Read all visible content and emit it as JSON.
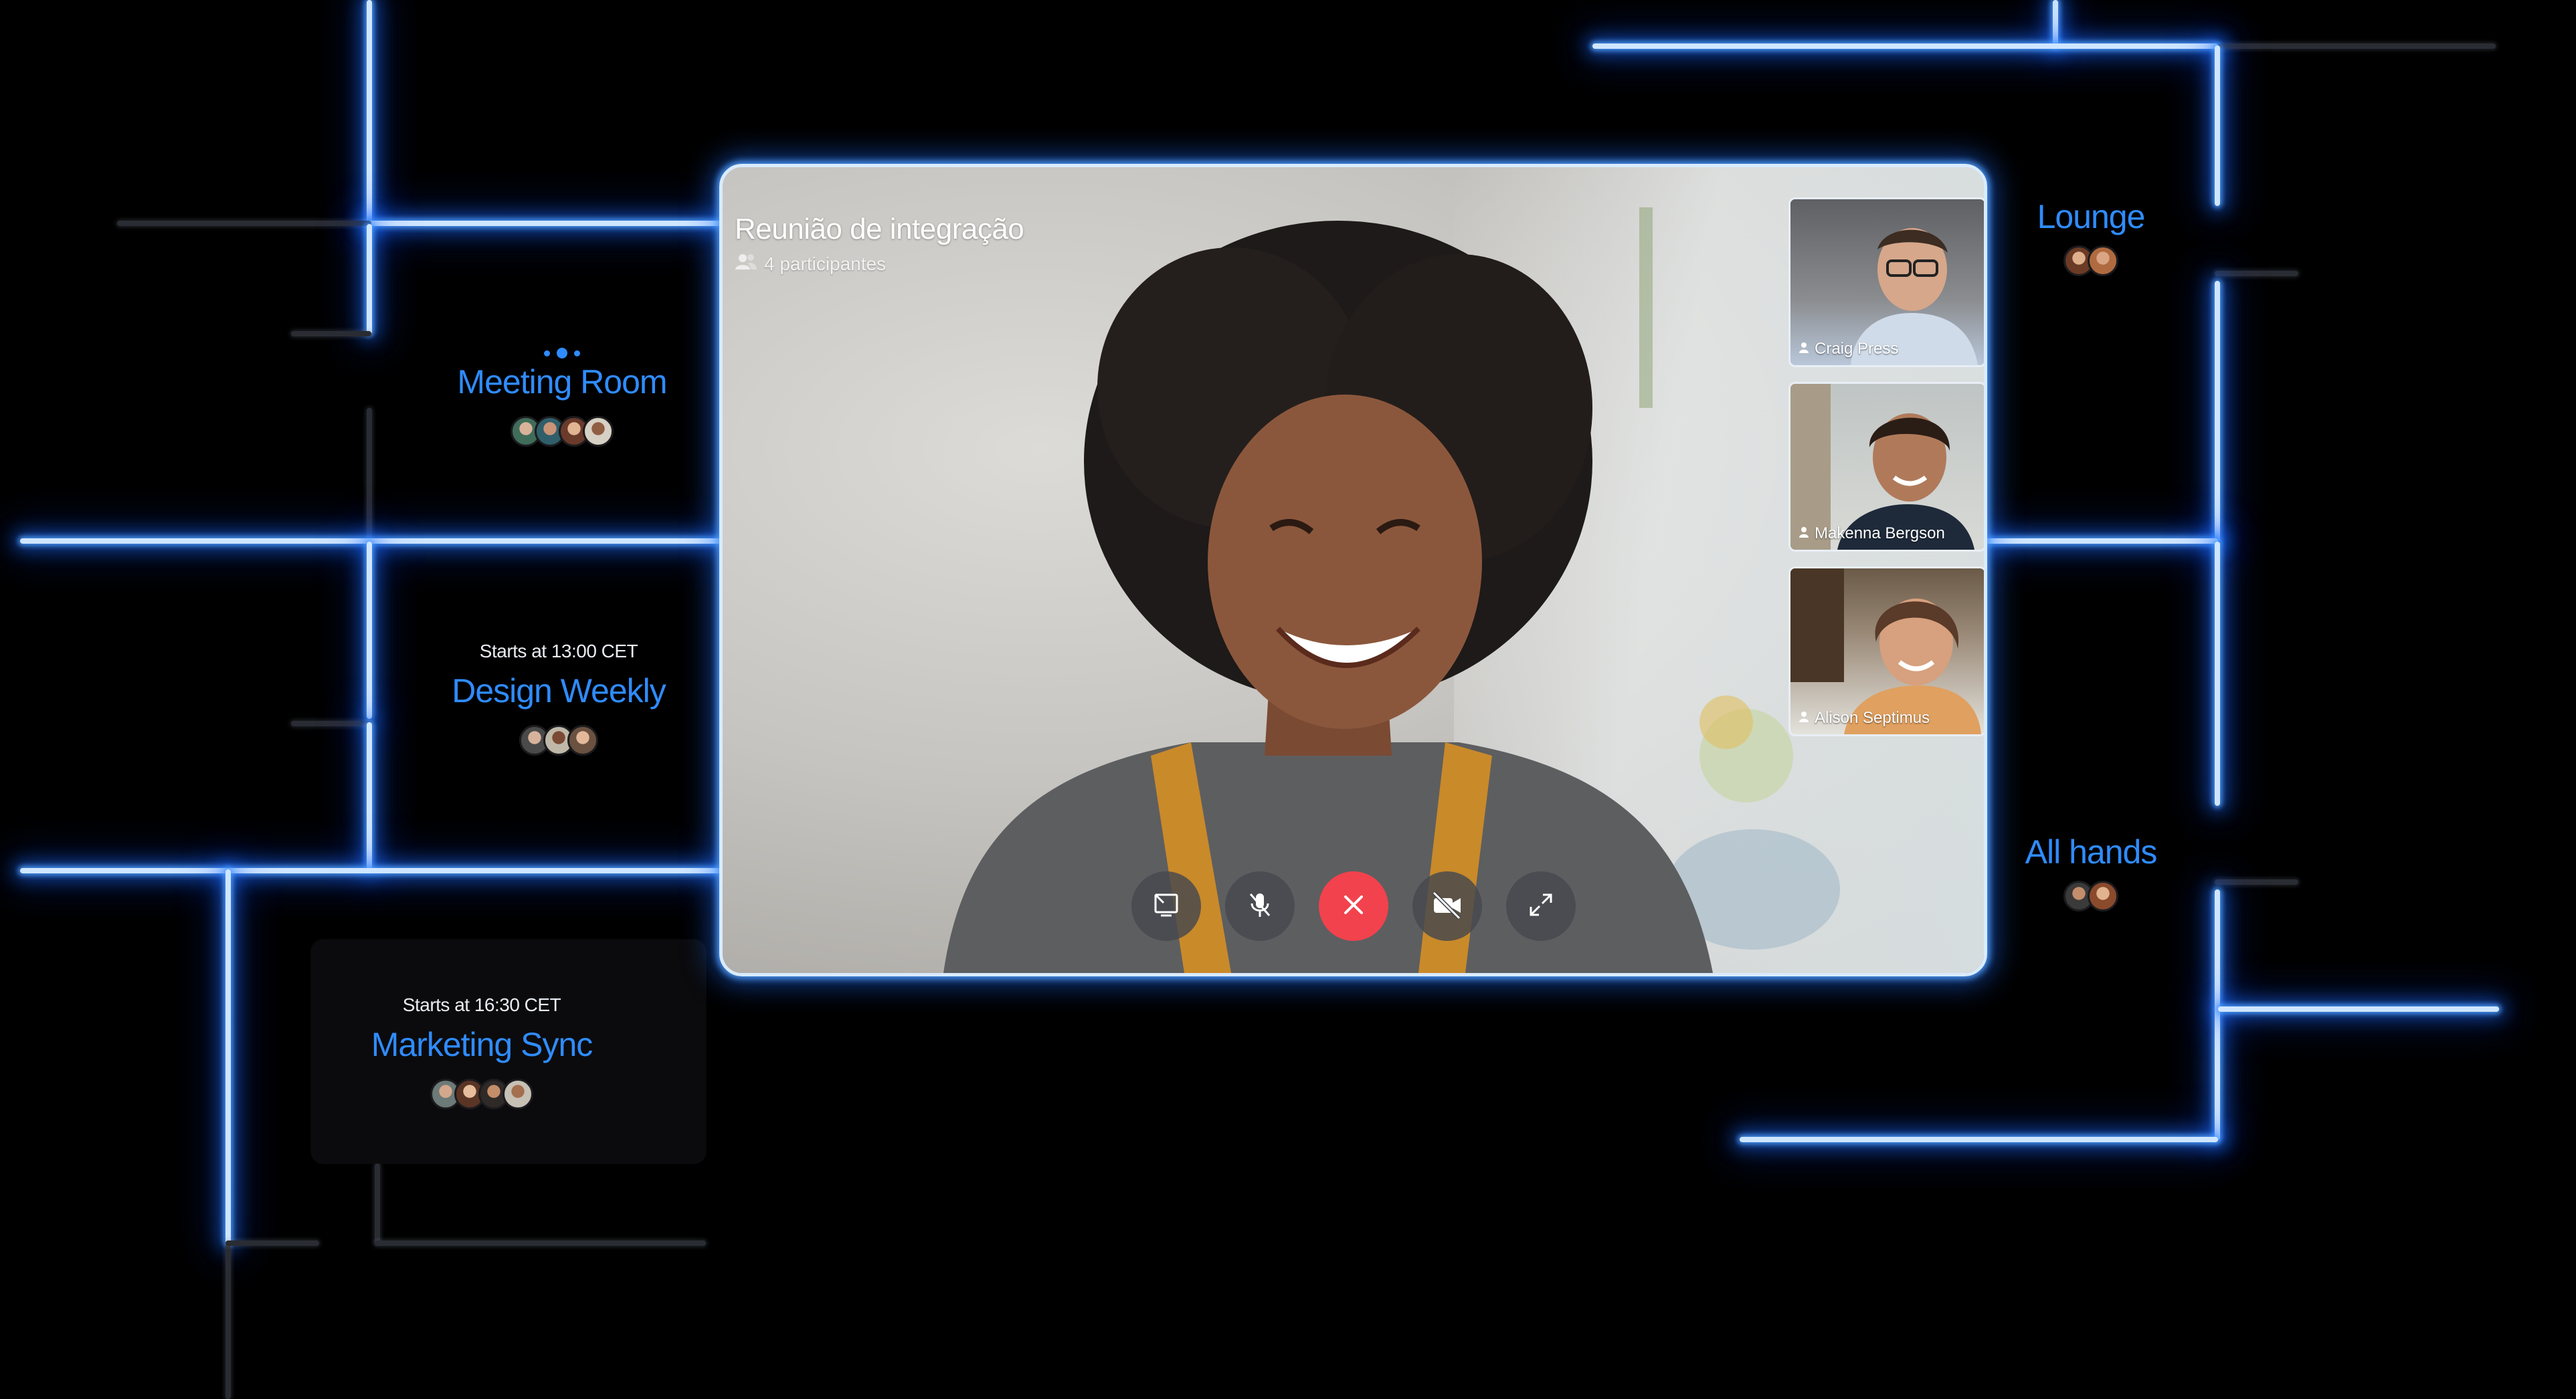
{
  "call": {
    "title": "Reunião de integração",
    "participants": "4 participantes",
    "thumbnails": [
      {
        "name": "Craig Press"
      },
      {
        "name": "Makenna Bergson"
      },
      {
        "name": "Alison Septimus"
      }
    ],
    "controls": [
      "screen-share",
      "mute-microphone",
      "end-call",
      "camera-off",
      "fullscreen"
    ]
  },
  "rooms": {
    "meeting_room": {
      "title": "Meeting Room"
    },
    "design_weekly": {
      "starts": "Starts at 13:00 CET",
      "title": "Design Weekly"
    },
    "marketing_sync": {
      "starts": "Starts at 16:30 CET",
      "title": "Marketing Sync"
    },
    "lounge": {
      "title": "Lounge"
    },
    "all_hands": {
      "title": "All hands"
    }
  },
  "colors": {
    "accent": "#2f8cff",
    "glow": "#3a8dff",
    "end_call": "#f2424d",
    "background": "#000000"
  }
}
